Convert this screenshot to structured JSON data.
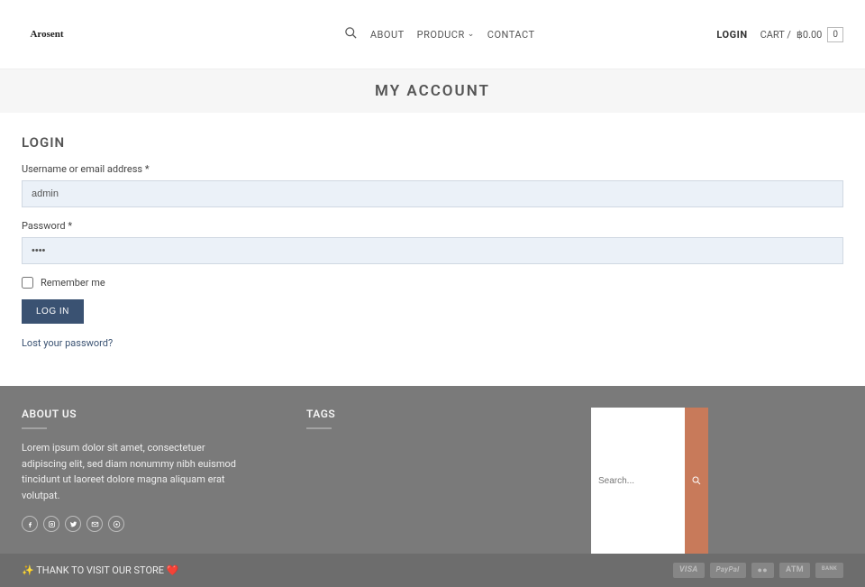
{
  "header": {
    "logo_text": "Arosent",
    "nav": {
      "about": "ABOUT",
      "producr": "PRODUCR",
      "contact": "CONTACT"
    },
    "login": "LOGIN",
    "cart_label": "CART / ",
    "cart_amount": "฿0.00",
    "cart_count": "0"
  },
  "page": {
    "title": "MY ACCOUNT"
  },
  "login_form": {
    "heading": "LOGIN",
    "username_label": "Username or email address *",
    "username_value": "admin",
    "password_label": "Password *",
    "password_value": "••••",
    "remember_label": "Remember me",
    "submit_label": "LOG IN",
    "lost_password": "Lost your password?"
  },
  "footer": {
    "about_heading": "ABOUT US",
    "about_text": "Lorem ipsum dolor sit amet, consectetuer adipiscing elit, sed diam nonummy nibh euismod tincidunt ut laoreet dolore magna aliquam erat volutpat.",
    "tags_heading": "TAGS",
    "search_placeholder": "Search...",
    "thank_text": "✨ THANK TO VISIT OUR STORE ❤️",
    "payments": [
      "VISA",
      "PayPal",
      "●●",
      "ATM",
      "BANK"
    ]
  }
}
